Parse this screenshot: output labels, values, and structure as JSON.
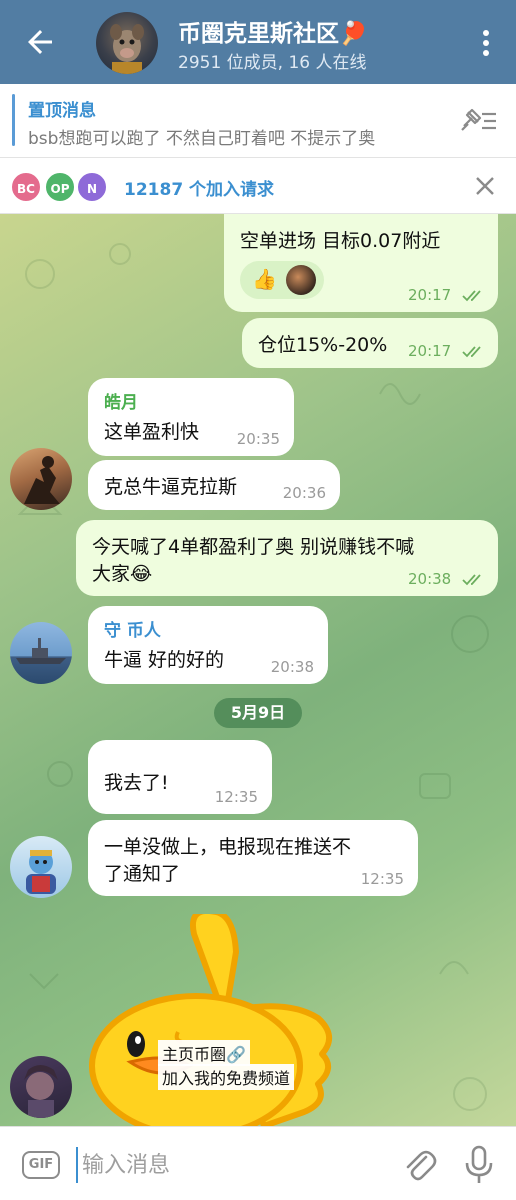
{
  "header": {
    "title": "币圈克里斯社区🏓",
    "subtitle": "2951 位成员, 16 人在线"
  },
  "pinned": {
    "title": "置顶消息",
    "text": "bsb想跑可以跑了 不然自己盯着吧  不提示了奥"
  },
  "join_requests": {
    "avatars": [
      "BC",
      "OP",
      "N"
    ],
    "avatar_colors": [
      "#e46b8d",
      "#4fb56a",
      "#8e6ad8"
    ],
    "text": "12187 个加入请求"
  },
  "messages": [
    {
      "type": "out",
      "text": "空单进场  目标0.07附近",
      "time": "20:17",
      "reactions": [
        "👍"
      ]
    },
    {
      "type": "out",
      "text": "仓位15%-20%",
      "time": "20:17"
    },
    {
      "type": "in",
      "sender": "皓月",
      "text": "这单盈利快",
      "time": "20:35"
    },
    {
      "type": "in",
      "text": "克总牛逼克拉斯",
      "time": "20:36"
    },
    {
      "type": "out",
      "text_line1": "今天喊了4单都盈利了奥  别说赚钱不喊",
      "text_line2": "大家😂",
      "time": "20:38"
    },
    {
      "type": "in",
      "sender": "守 币人",
      "text": "牛逼  好的好的",
      "time": "20:38"
    },
    {
      "type": "in",
      "text": "我去了!",
      "time": "12:35"
    },
    {
      "type": "in",
      "text_line1": "一单没做上，电报现在推送不",
      "text_line2": "了通知了",
      "time": "12:35"
    }
  ],
  "date_separator": "5月9日",
  "sticker": {
    "label_line1": "主页币圈🔗",
    "label_line2": "加入我的免费频道"
  },
  "composer": {
    "gif_label": "GIF",
    "placeholder": "输入消息"
  },
  "colors": {
    "header_bg": "#527da3",
    "accent": "#3b8fd0",
    "outgoing_bubble": "#effdde",
    "sender_green": "#4caf50",
    "sender_blue": "#3b8fd0"
  }
}
